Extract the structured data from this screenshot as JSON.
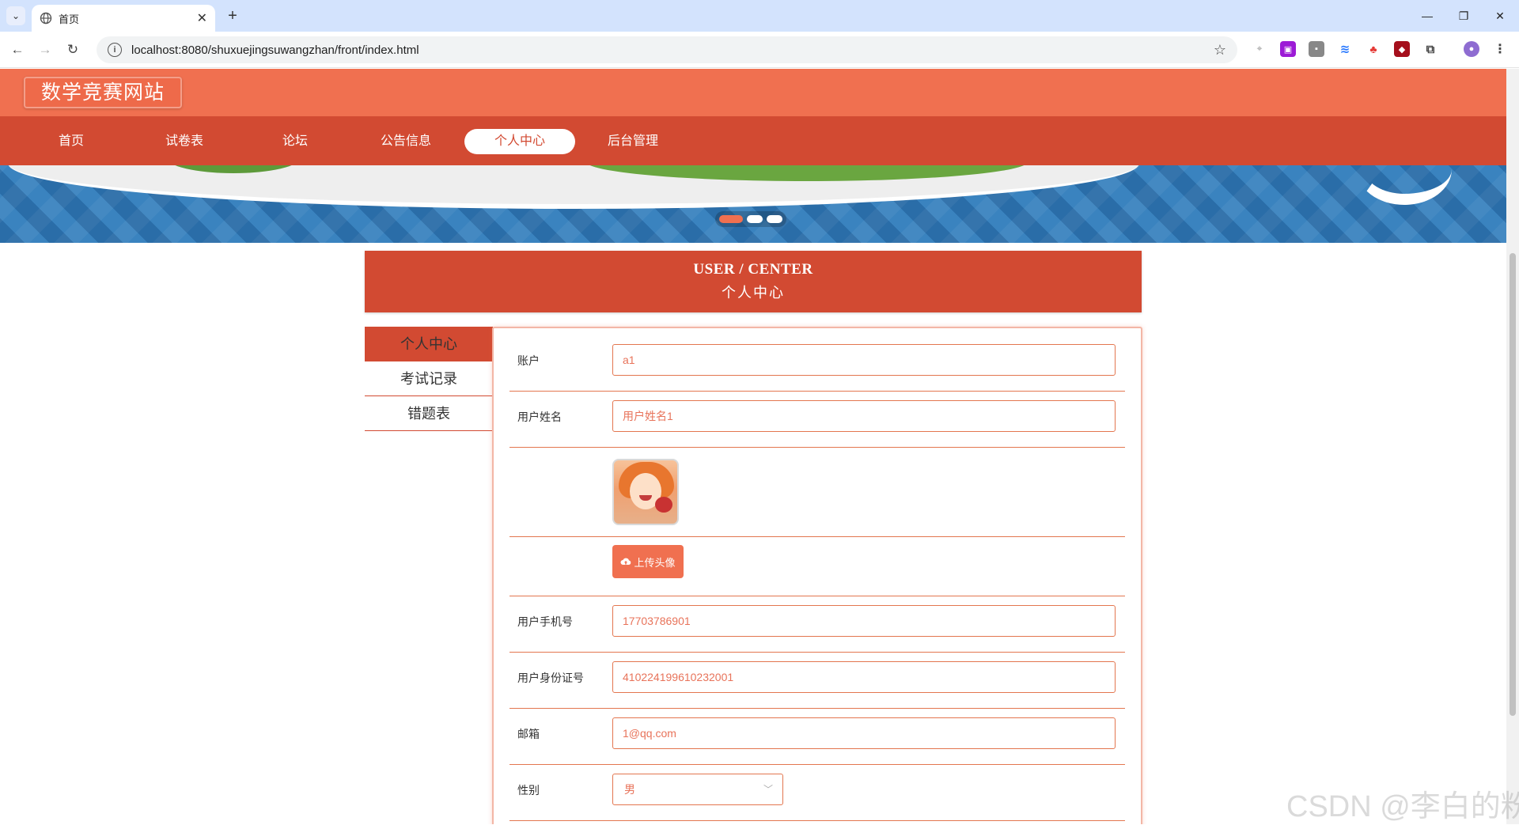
{
  "browser": {
    "tab_title": "首页",
    "url": "localhost:8080/shuxuejingsuwangzhan/front/index.html"
  },
  "site": {
    "title": "数学竞赛网站",
    "nav": [
      "首页",
      "试卷表",
      "论坛",
      "公告信息",
      "个人中心",
      "后台管理"
    ],
    "active_nav": "个人中心"
  },
  "user_center": {
    "title_en": "USER / CENTER",
    "title_cn": "个人中心"
  },
  "side_menu": [
    "个人中心",
    "考试记录",
    "错题表"
  ],
  "form": {
    "account_label": "账户",
    "account_value": "a1",
    "name_label": "用户姓名",
    "name_value": "用户姓名1",
    "upload_label": "上传头像",
    "phone_label": "用户手机号",
    "phone_value": "17703786901",
    "idcard_label": "用户身份证号",
    "idcard_value": "410224199610232001",
    "email_label": "邮箱",
    "email_value": "1@qq.com",
    "gender_label": "性别",
    "gender_value": "男"
  },
  "watermark": "CSDN @李白的粉",
  "colors": {
    "header": "#f07050",
    "nav": "#d24a32",
    "accent": "#e3764f"
  }
}
